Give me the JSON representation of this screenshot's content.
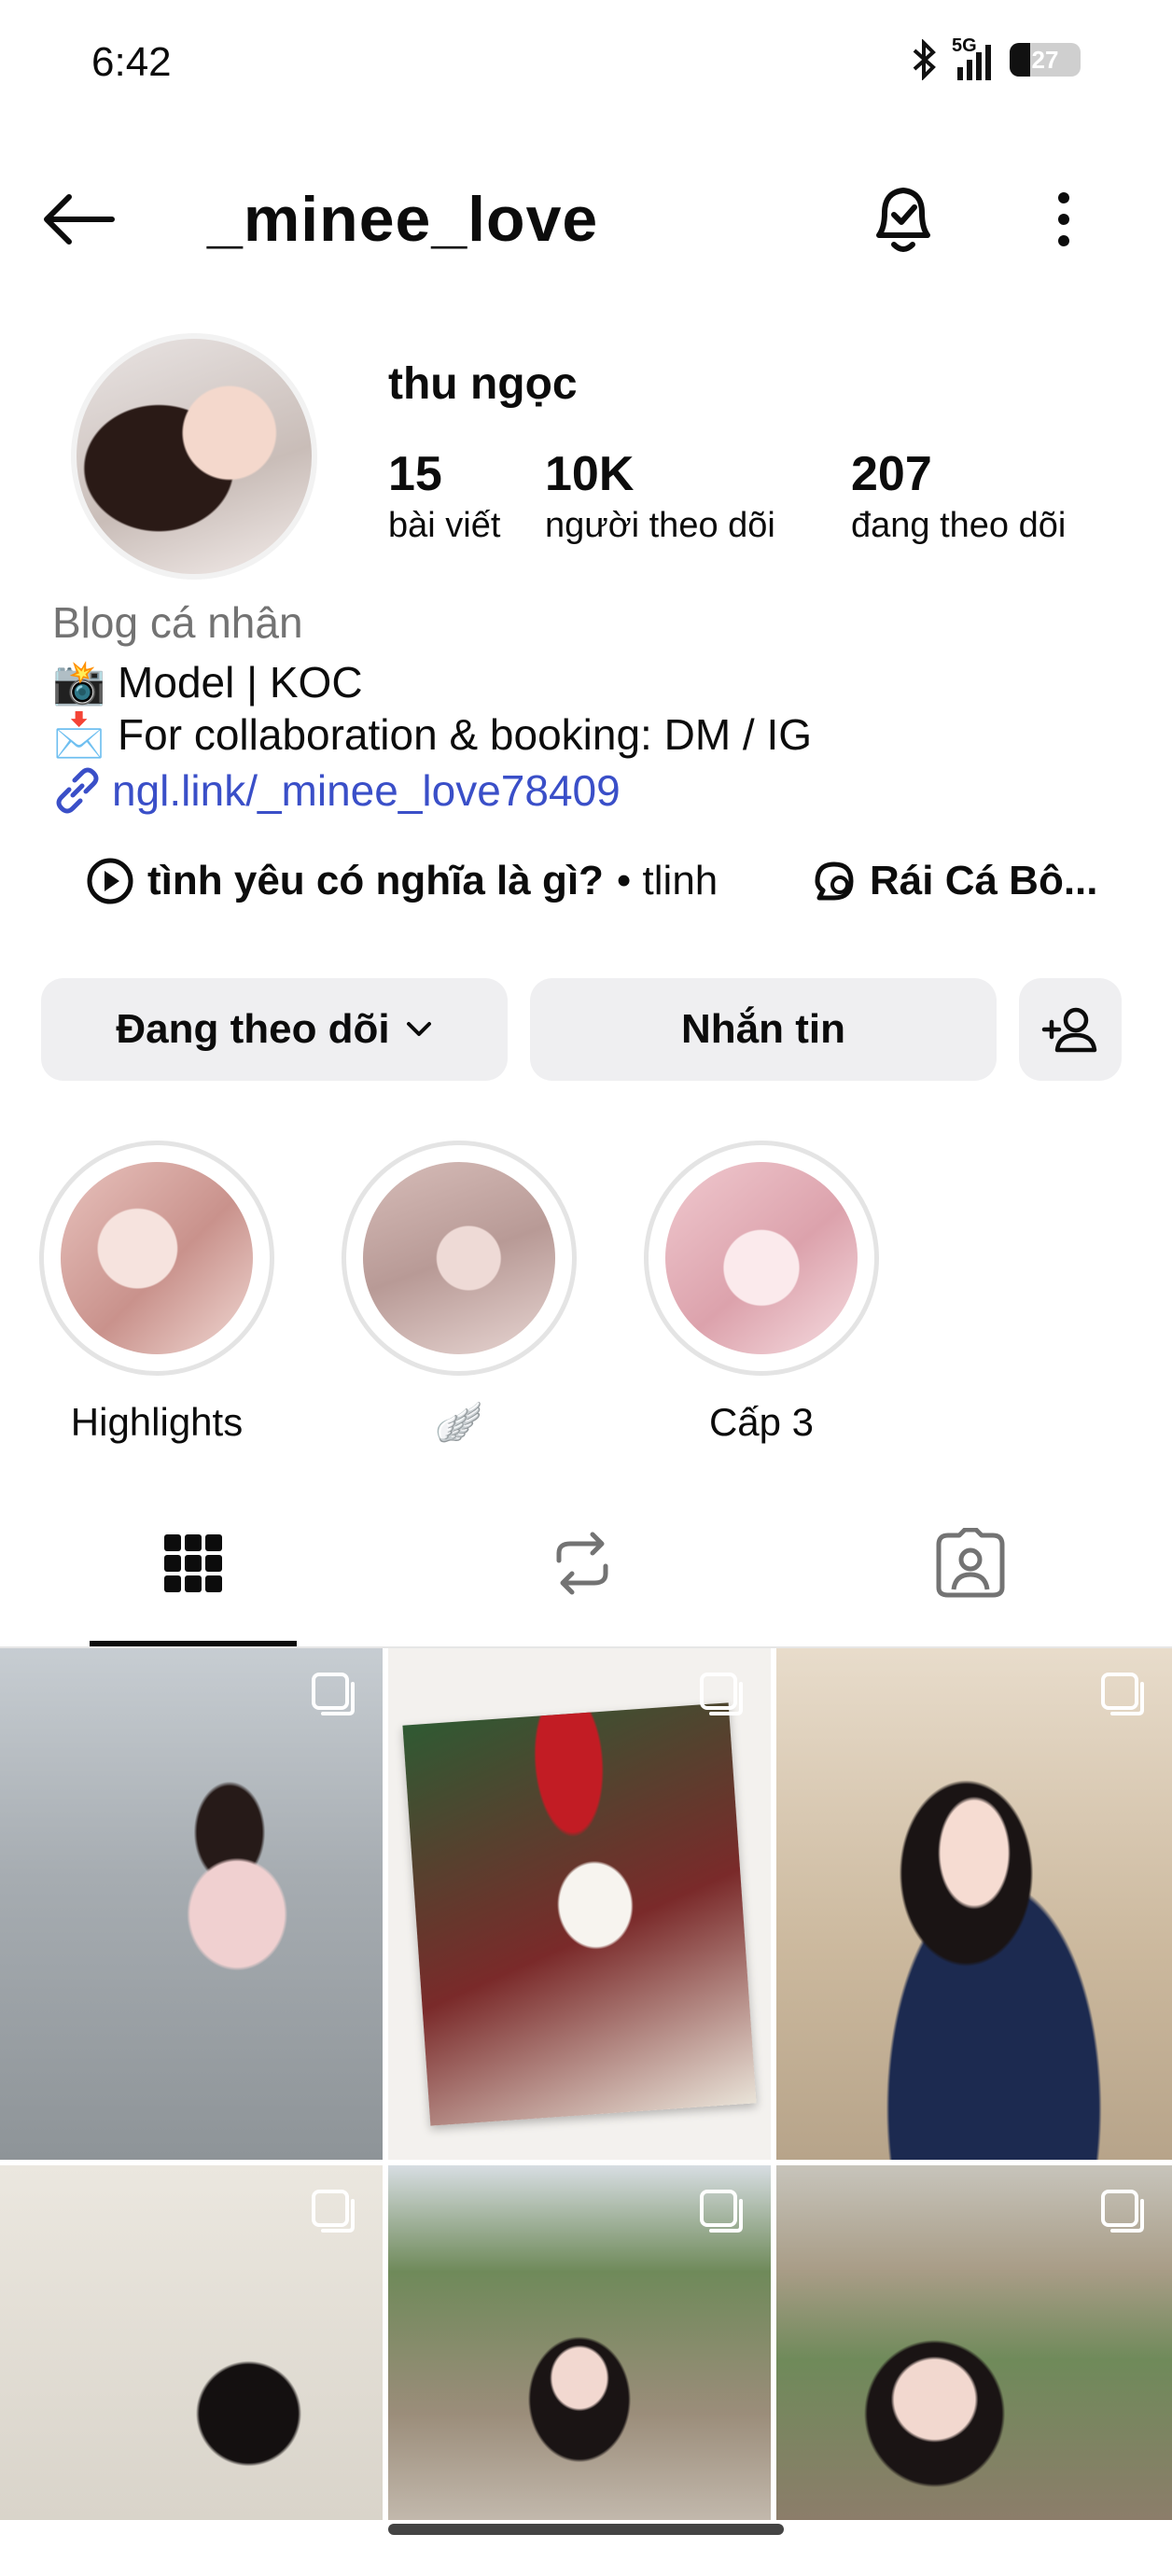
{
  "status_bar": {
    "time": "6:42",
    "network": "5G",
    "battery": "27"
  },
  "header": {
    "username": "_minee_love"
  },
  "profile": {
    "display_name": "thu ngọc",
    "stats": [
      {
        "value": "15",
        "label": "bài viết"
      },
      {
        "value": "10K",
        "label": "người theo dõi"
      },
      {
        "value": "207",
        "label": "đang theo dõi"
      }
    ],
    "category": "Blog cá nhân",
    "bio_line1": "📸 Model | KOC",
    "bio_line2": "📩 For collaboration & booking: DM / IG",
    "link": "ngl.link/_minee_love78409",
    "music_song": "tình yêu có nghĩa là gì?",
    "music_artist": "• tlinh",
    "thread_text": "Rái Cá Bô..."
  },
  "actions": {
    "following_label": "Đang theo dõi",
    "message_label": "Nhắn tin"
  },
  "highlights": [
    {
      "label": "Highlights"
    },
    {
      "label": "🪽"
    },
    {
      "label": "Cấp 3"
    }
  ],
  "tabs": [
    {
      "name": "posts-grid-icon"
    },
    {
      "name": "reposts-icon"
    },
    {
      "name": "tagged-icon"
    }
  ],
  "colors": {
    "link": "#3a4fc8",
    "button_bg": "#efeff1",
    "secondary_text": "#737373"
  }
}
